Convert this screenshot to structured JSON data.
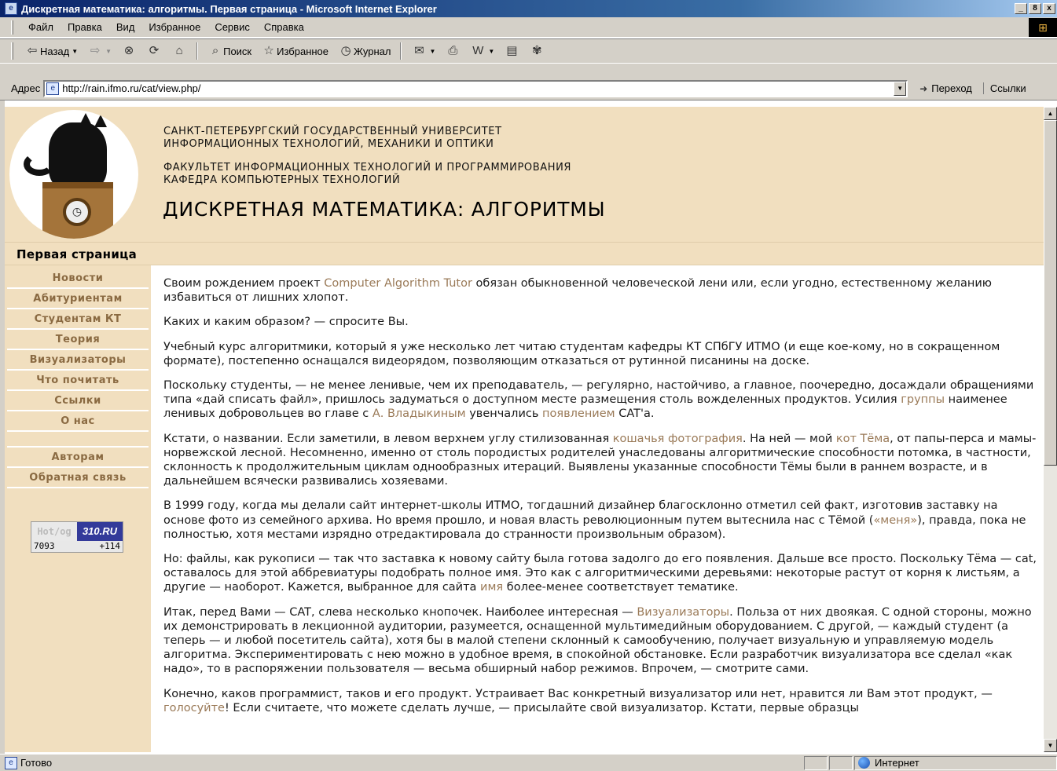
{
  "window": {
    "title": "Дискретная математика: алгоритмы. Первая страница - Microsoft Internet Explorer",
    "btn_minimize": "_",
    "btn_restore": "8",
    "btn_close": "x"
  },
  "menu": {
    "items": [
      "Файл",
      "Правка",
      "Вид",
      "Избранное",
      "Сервис",
      "Справка"
    ]
  },
  "toolbar": {
    "back_label": "Назад",
    "search_label": "Поиск",
    "favorites_label": "Избранное",
    "history_label": "Журнал"
  },
  "address": {
    "label": "Адрес",
    "url": "http://rain.ifmo.ru/cat/view.php/",
    "go_label": "Переход",
    "links_label": "Ссылки"
  },
  "header": {
    "university_line1": "САНКТ-ПЕТЕРБУРГСКИЙ ГОСУДАРСТВЕННЫЙ УНИВЕРСИТЕТ",
    "university_line2": "ИНФОРМАЦИОННЫХ ТЕХНОЛОГИЙ, МЕХАНИКИ И ОПТИКИ",
    "faculty_line1": "ФАКУЛЬТЕТ ИНФОРМАЦИОННЫХ ТЕХНОЛОГИЙ И ПРОГРАММИРОВАНИЯ",
    "faculty_line2": "КАФЕДРА КОМПЬЮТЕРНЫХ ТЕХНОЛОГИЙ",
    "site_title": "ДИСКРЕТНАЯ МАТЕМАТИКА: АЛГОРИТМЫ"
  },
  "breadcrumb": {
    "current": "Первая страница"
  },
  "sidebar": {
    "items": [
      "Новости",
      "Абитуриентам",
      "Студентам КТ",
      "Теория",
      "Визуализаторы",
      "Что почитать",
      "Ссылки",
      "О нас"
    ],
    "items2": [
      "Авторам",
      "Обратная связь"
    ]
  },
  "counter": {
    "left": "Hot/og",
    "right": "310.RU",
    "total": "7093",
    "today": "+114"
  },
  "content": {
    "p1_a": "Своим рождением проект ",
    "p1_link": "Computer Algorithm Tutor",
    "p1_b": " обязан обыкновенной человеческой лени или, если угодно, естественному желанию избавиться от лишних хлопот.",
    "p2": "Каких и каким образом? — спросите Вы.",
    "p3": "Учебный курс алгоритмики, который я уже несколько лет читаю студентам кафедры КТ СПбГУ ИТМО (и еще кое-кому, но в сокращенном формате), постепенно оснащался видеорядом, позволяющим отказаться от рутинной писанины на доске.",
    "p4_a": "Поскольку студенты, — не менее ленивые, чем их преподаватель, — регулярно, настойчиво, а главное, поочередно, досаждали обращениями типа «дай списать файл», пришлось задуматься о доступном месте размещения столь вожделенных продуктов. Усилия ",
    "p4_link1": "группы",
    "p4_b": " наименее ленивых добровольцев во главе с ",
    "p4_link2": "А. Владыкиным",
    "p4_c": " увенчались ",
    "p4_link3": "появлением",
    "p4_d": " CAT'а.",
    "p5_a": "Кстати, о названии. Если заметили, в левом верхнем углу стилизованная ",
    "p5_link1": "кошачья фотография",
    "p5_b": ". На ней — мой ",
    "p5_link2": "кот Тёма",
    "p5_c": ", от папы-перса и мамы-норвежской лесной. Несомненно, именно от столь породистых родителей унаследованы алгоритмические способности потомка, в частности, склонность к продолжительным циклам однообразных итераций. Выявлены указанные способности Тёмы были в раннем возрасте, и в дальнейшем всячески развивались хозяевами.",
    "p6_a": "В 1999 году, когда мы делали сайт интернет-школы ИТМО, тогдашний дизайнер благосклонно отметил сей факт, изготовив заставку на основе фото из семейного архива. Но время прошло, и новая власть революционным путем вытеснила нас с Тёмой (",
    "p6_link": "«меня»",
    "p6_b": "), правда, пока не полностью, хотя местами изрядно отредактировала до странности произвольным образом).",
    "p7_a": "Но: файлы, как рукописи — так что заставка к новому сайту была готова задолго до его появления. Дальше все просто. Поскольку Тёма — cat, оставалось для этой аббревиатуры подобрать полное имя. Это как с алгоритмическими деревьями: некоторые растут от корня к листьям, а другие — наоборот. Кажется, выбранное для сайта ",
    "p7_link": "имя",
    "p7_b": " более-менее соответствует тематике.",
    "p8_a": "Итак, перед Вами — CAT, слева несколько кнопочек. Наиболее интересная — ",
    "p8_link": "Визуализаторы",
    "p8_b": ". Польза от них двоякая. С одной стороны, можно их демонстрировать в лекционной аудитории, разумеется, оснащенной мультимедийным оборудованием. С другой, — каждый студент (а теперь — и любой посетитель сайта), хотя бы в малой степени склонный к самообучению, получает визуальную и управляемую модель алгоритма. Экспериментировать с нею можно в удобное время, в спокойной обстановке. Если разработчик визуализатора все сделал «как надо», то в распоряжении пользователя — весьма обширный набор режимов. Впрочем, — смотрите сами.",
    "p9_a": "Конечно, каков программист, таков и его продукт. Устраивает Вас конкретный визуализатор или нет, нравится ли Вам этот продукт, — ",
    "p9_link": "голосуйте",
    "p9_b": "! Если считаете, что можете сделать лучше, — присылайте свой визуализатор. Кстати, первые образцы"
  },
  "status": {
    "text": "Готово",
    "zone": "Интернет"
  }
}
